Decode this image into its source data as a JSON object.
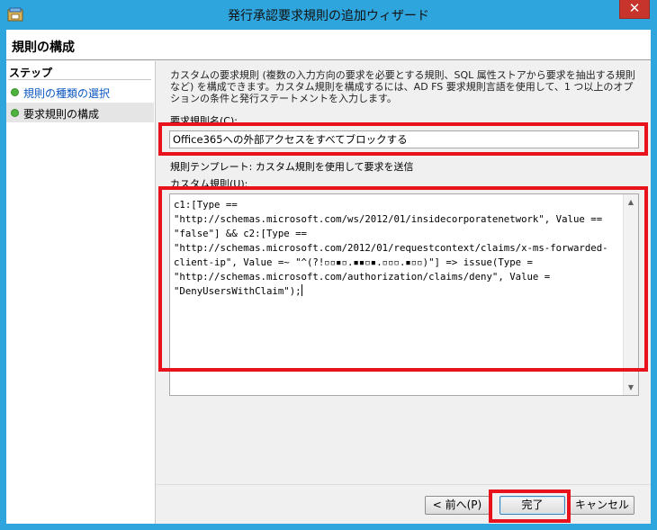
{
  "window": {
    "title": "発行承認要求規則の追加ウィザード",
    "close_label": "✕"
  },
  "header": {
    "title": "規則の構成"
  },
  "steps": {
    "heading": "ステップ",
    "items": [
      {
        "label": "規則の種類の選択"
      },
      {
        "label": "要求規則の構成"
      }
    ]
  },
  "main": {
    "description": "カスタムの要求規則 (複数の入力方向の要求を必要とする規則、SQL 属性ストアから要求を抽出する規則など) を構成できます。カスタム規則を構成するには、AD FS 要求規則言語を使用して、1 つ以上のオプションの条件と発行ステートメントを入力します。",
    "rule_name_label": "要求規則名(C):",
    "rule_name_value": "Office365への外部アクセスをすべてブロックする",
    "template_text": "規則テンプレート: カスタム規則を使用して要求を送信",
    "custom_rule_label": "カスタム規則(U):",
    "custom_rule_text": "c1:[Type == \"http://schemas.microsoft.com/ws/2012/01/insidecorporatenetwork\", Value == \"false\"] && c2:[Type == \"http://schemas.microsoft.com/2012/01/requestcontext/claims/x-ms-forwarded-client-ip\", Value =~ \"^(?!▫▫▪▫.▪▪▫▪.▫▫▫.▪▫▫)\"] => issue(Type = \"http://schemas.microsoft.com/authorization/claims/deny\", Value = \"DenyUsersWithClaim\");"
  },
  "buttons": {
    "back": "< 前へ(P)",
    "finish": "完了",
    "cancel": "キャンセル"
  },
  "colors": {
    "titlebar": "#2fa5dd",
    "highlight": "#e8121c",
    "close": "#c7342c"
  }
}
